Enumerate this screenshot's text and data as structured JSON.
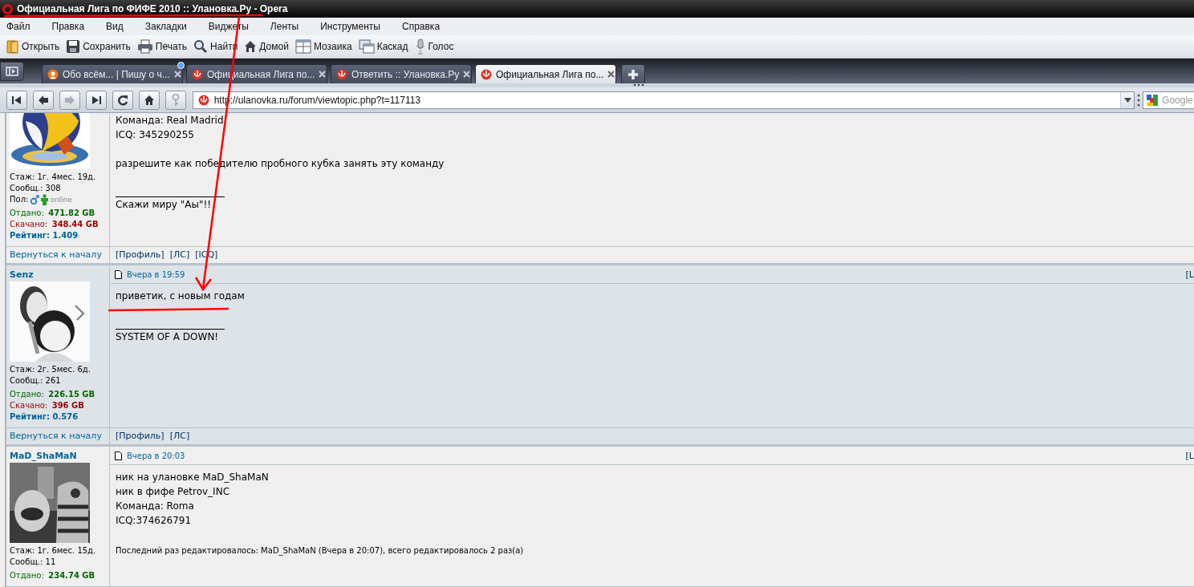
{
  "window": {
    "title": "Официальная Лига по ФИФЕ 2010 :: Улановка.Ру - Opera"
  },
  "menu": [
    "Файл",
    "Правка",
    "Вид",
    "Закладки",
    "Виджеты",
    "Ленты",
    "Инструменты",
    "Справка"
  ],
  "toolbar": [
    {
      "kind": "open",
      "label": "Открыть"
    },
    {
      "kind": "save",
      "label": "Сохранить"
    },
    {
      "kind": "print",
      "label": "Печать"
    },
    {
      "kind": "find",
      "label": "Найти"
    },
    {
      "kind": "home",
      "label": "Домой"
    },
    {
      "kind": "tile",
      "label": "Мозаика"
    },
    {
      "kind": "cascade",
      "label": "Каскад"
    },
    {
      "kind": "voice",
      "label": "Голос"
    }
  ],
  "tabs": [
    {
      "kind": "blog",
      "label": "Обо всём... | Пишу о ч...",
      "selected": false,
      "unread": true
    },
    {
      "kind": "forum",
      "label": "Официальная Лига по...",
      "selected": false,
      "unread": false
    },
    {
      "kind": "forum",
      "label": "Ответить :: Улановка.Ру",
      "selected": false,
      "unread": false
    },
    {
      "kind": "forum",
      "label": "Официальная Лига по...",
      "selected": true,
      "unread": false
    }
  ],
  "nav_buttons": [
    {
      "kind": "rewind",
      "disabled": false
    },
    {
      "kind": "back",
      "disabled": false
    },
    {
      "kind": "forward",
      "disabled": true
    },
    {
      "kind": "fastforward",
      "disabled": false
    },
    {
      "kind": "reload",
      "disabled": false
    },
    {
      "kind": "home",
      "disabled": false
    },
    {
      "kind": "key",
      "disabled": true
    }
  ],
  "address": {
    "value": "http://ulanovka.ru/forum/viewtopic.php?t=117113"
  },
  "search": {
    "placeholder": "Google"
  },
  "posts": [
    {
      "avatar": {
        "kind": "picture"
      },
      "tenure": "Стаж: 1г. 4мес. 19д.",
      "count": "Сообщ.: 308",
      "gender": {
        "label": "Пол:",
        "status": "online"
      },
      "uploaded": {
        "label": "Отдано:",
        "value": "471.82 GB"
      },
      "downloaded": {
        "label": "Скачано:",
        "value": "348.44 GB"
      },
      "rating": {
        "label": "Рейтинг:",
        "value": "1.409"
      },
      "body": [
        [
          "Команда: Real Madrid",
          "ICQ: 345290255"
        ],
        [
          "разрешите как победителю пробного кубка занять эту команду"
        ]
      ],
      "signature": "Скажи миру \"Аы\"!!",
      "back": "Вернуться к началу",
      "links": [
        "[Профиль]",
        "[ЛС]",
        "[ICQ]"
      ]
    },
    {
      "author": "Senz",
      "time": "Вчера в 19:59",
      "corner": "[L",
      "avatar": {
        "kind": "picture"
      },
      "tenure": "Стаж: 2г. 5мес. 6д.",
      "count": "Сообщ.: 261",
      "uploaded": {
        "label": "Отдано:",
        "value": "226.15 GB"
      },
      "downloaded": {
        "label": "Скачано:",
        "value": "396 GB"
      },
      "rating": {
        "label": "Рейтинг:",
        "value": "0.576"
      },
      "body": [
        [
          "приветик, с новым годам"
        ]
      ],
      "signature": "SYSTEM OF A DOWN!",
      "back": "Вернуться к началу",
      "links": [
        "[Профиль]",
        "[ЛС]"
      ]
    },
    {
      "author": "MaD_ShaMaN",
      "time": "Вчера в 20:03",
      "corner": "[L",
      "avatar": {
        "kind": "picture"
      },
      "tenure": "Стаж: 1г. 6мес. 15д.",
      "count": "Сообщ.: 11",
      "uploaded": {
        "label": "Отдано:",
        "value": "234.74 GB"
      },
      "body": [
        [
          "ник на улановке MaD_ShaMaN",
          "ник в фифе Petrov_INC",
          "Команда: Roma",
          "ICQ:374626791"
        ]
      ],
      "edit_note": "Последний раз редактировалось: MaD_ShaMaN (Вчера в 20:07), всего редактировалось 2 раз(а)"
    }
  ]
}
